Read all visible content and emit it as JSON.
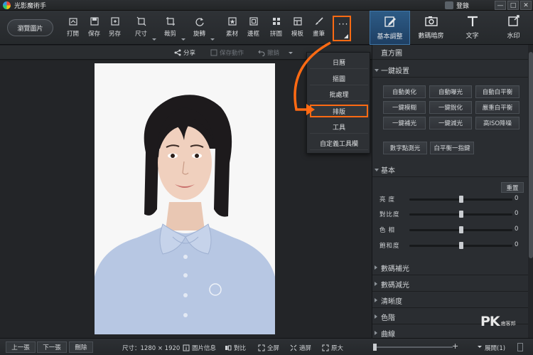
{
  "window": {
    "title": "光影魔術手",
    "login": "登錄",
    "controls": [
      "—",
      "□",
      "✕"
    ]
  },
  "toolbar": {
    "browse": "瀏覽圖片",
    "tools": [
      {
        "name": "open",
        "label": "打開"
      },
      {
        "name": "save",
        "label": "保存"
      },
      {
        "name": "saveas",
        "label": "另存"
      },
      {
        "name": "size",
        "label": "尺寸"
      },
      {
        "name": "crop",
        "label": "裁剪"
      },
      {
        "name": "rotate",
        "label": "旋轉"
      },
      {
        "name": "material",
        "label": "素材"
      },
      {
        "name": "border",
        "label": "邊框"
      },
      {
        "name": "collage",
        "label": "拼圖"
      },
      {
        "name": "template",
        "label": "模板"
      },
      {
        "name": "paint",
        "label": "畫筆"
      }
    ],
    "more": "···"
  },
  "right_tabs": [
    {
      "label": "基本調整",
      "icon": "edit-icon",
      "active": true
    },
    {
      "label": "數碼暗房",
      "icon": "camera-icon",
      "active": false
    },
    {
      "label": "文字",
      "icon": "text-icon",
      "active": false
    },
    {
      "label": "水印",
      "icon": "watermark-icon",
      "active": false
    }
  ],
  "subbar": {
    "share": "分享",
    "save_action": "保存動作",
    "undo": "撤銷"
  },
  "menu": {
    "items": [
      "日曆",
      "摳圖",
      "批處理",
      "排版",
      "工具",
      "自定義工具欄"
    ],
    "highlighted": "排版"
  },
  "panel": {
    "histogram": "直方圖",
    "one_click": "一鍵設置",
    "buttons": [
      [
        "自動美化",
        "自動曝光",
        "自動白平衡"
      ],
      [
        "一鍵模糊",
        "一鍵銳化",
        "嚴重白平衡"
      ],
      [
        "一鍵補光",
        "一鍵減光",
        "高ISO降噪"
      ]
    ],
    "buttons2": [
      "數字點測光",
      "白平衡一指鍵"
    ],
    "basic": "基本",
    "reset": "重置",
    "sliders": [
      {
        "label": "亮度",
        "value": "0",
        "level": 0.5
      },
      {
        "label": "對比度",
        "value": "0",
        "level": 0.5
      },
      {
        "label": "色相",
        "value": "0",
        "level": 0.5
      },
      {
        "label": "飽和度",
        "value": "0",
        "level": 0.5
      }
    ],
    "sections": [
      "數碼補光",
      "數碼減光",
      "清晰度",
      "色階",
      "曲線"
    ]
  },
  "status": {
    "prev": "上一張",
    "next": "下一張",
    "delete": "刪除",
    "size": "尺寸：1280 × 1920",
    "info": "圖片信息",
    "compare": "對比",
    "fullscreen": "全屏",
    "fit": "適屏",
    "original": "原大",
    "zoom_level": 0.0,
    "expand": "展開(1)"
  },
  "watermark": {
    "pk": "PK",
    "sub": "痞客邦"
  },
  "colors": {
    "accent": "#ff6a13",
    "active_tab": "#2d5b86"
  }
}
